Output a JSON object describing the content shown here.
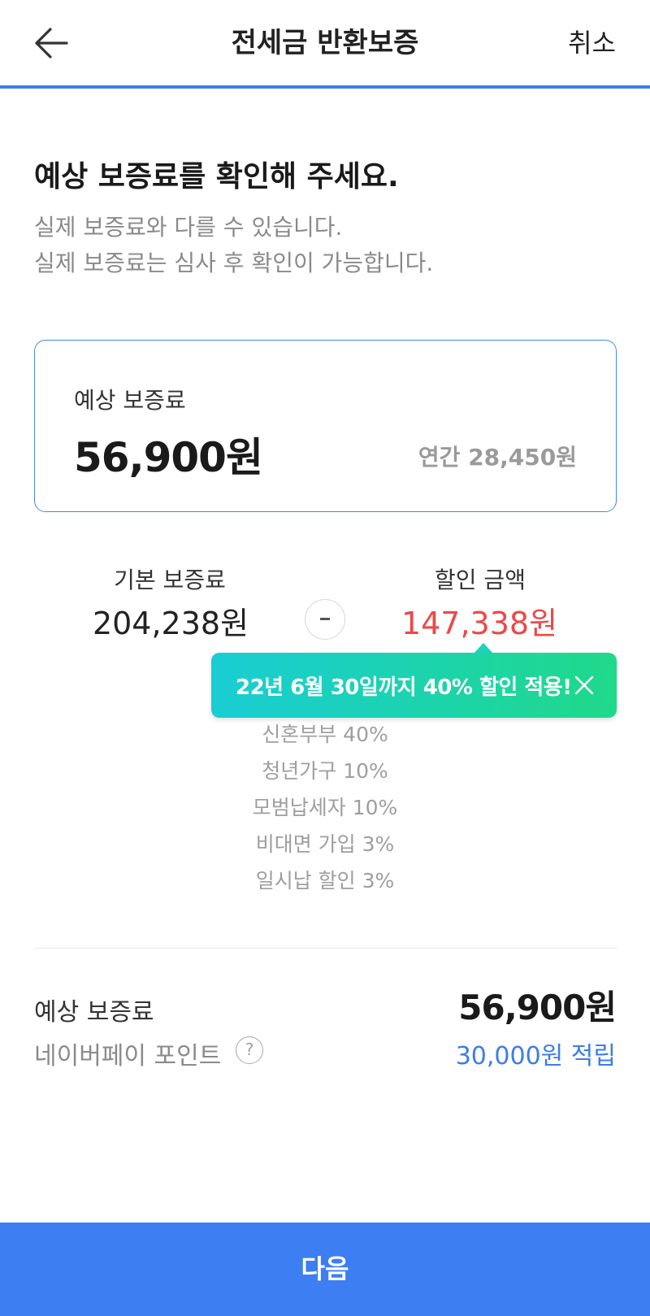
{
  "header": {
    "title": "전세금 반환보증",
    "cancel_label": "취소",
    "back_icon": "arrow-left-icon"
  },
  "intro": {
    "headline": "예상 보증료를 확인해 주세요.",
    "sub_line_1": "실제 보증료와 다를 수 있습니다.",
    "sub_line_2": "실제 보증료는 심사 후 확인이 가능합니다."
  },
  "fee_card": {
    "label": "예상 보증료",
    "amount": "56,900원",
    "annual": "연간 28,450원"
  },
  "calculation": {
    "base_label": "기본 보증료",
    "base_amount": "204,238원",
    "operator_icon": "minus-icon",
    "discount_label": "할인 금액",
    "discount_amount": "147,338원"
  },
  "tooltip": {
    "text": "22년 6월 30일까지 40% 할인 적용!",
    "close_icon": "close-icon"
  },
  "discount_items": [
    "신혼부부 40%",
    "청년가구 10%",
    "모범납세자 10%",
    "비대면 가입 3%",
    "일시납 할인 3%"
  ],
  "summary": {
    "fee_label": "예상 보증료",
    "fee_amount": "56,900원",
    "point_label": "네이버페이 포인트",
    "help_symbol": "?",
    "point_value": "30,000원 적립"
  },
  "footer": {
    "next_label": "다음"
  },
  "colors": {
    "accent": "#3d7ef2",
    "discount_red": "#ee4848",
    "tooltip_start": "#19cdd4",
    "tooltip_end": "#1fd98a"
  }
}
